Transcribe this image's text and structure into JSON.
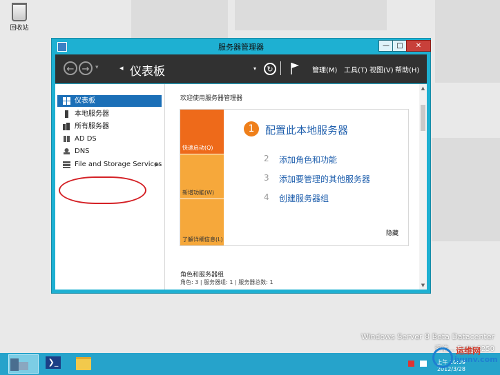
{
  "desktop": {
    "recycle_bin_label": "回收站",
    "watermark_line1": "Windows Server 8 Beta Datacenter",
    "watermark_line2": "评估... Build 8250"
  },
  "window": {
    "title": "服务器管理器",
    "controls": {
      "minimize": "—",
      "maximize": "□",
      "close": "✕"
    },
    "breadcrumb": "仪表板",
    "menus": [
      "管理(M)",
      "工具(T)",
      "视图(V)",
      "帮助(H)"
    ]
  },
  "sidebar": {
    "items": [
      {
        "label": "仪表板",
        "icon": "dashboard-icon",
        "active": true
      },
      {
        "label": "本地服务器",
        "icon": "server-icon"
      },
      {
        "label": "所有服务器",
        "icon": "servers-icon"
      },
      {
        "label": "AD DS",
        "icon": "ad-ds-icon"
      },
      {
        "label": "DNS",
        "icon": "dns-icon"
      },
      {
        "label": "File and Storage Services",
        "icon": "storage-icon"
      }
    ]
  },
  "main": {
    "welcome_title": "欢迎使用服务器管理器",
    "tiles": [
      {
        "label": "快速启动(Q)",
        "color": "#ee6a1a"
      },
      {
        "label": "新增功能(W)",
        "color": "#f6a83b"
      },
      {
        "label": "了解详细信息(L)",
        "color": "#f6a83b"
      }
    ],
    "tasks": [
      {
        "num": "1",
        "label": "配置此本地服务器"
      },
      {
        "num": "2",
        "label": "添加角色和功能"
      },
      {
        "num": "3",
        "label": "添加要管理的其他服务器"
      },
      {
        "num": "4",
        "label": "创建服务器组"
      }
    ],
    "hide_label": "隐藏",
    "roles_title": "角色和服务器组",
    "roles_summary": "角色: 3 | 服务器组: 1 | 服务器总数: 1"
  },
  "taskbar": {
    "time": "上午 10:09",
    "date": "2012/3/28"
  },
  "logo": {
    "text_cn": "运维网",
    "text_en": "iyunv.com"
  }
}
